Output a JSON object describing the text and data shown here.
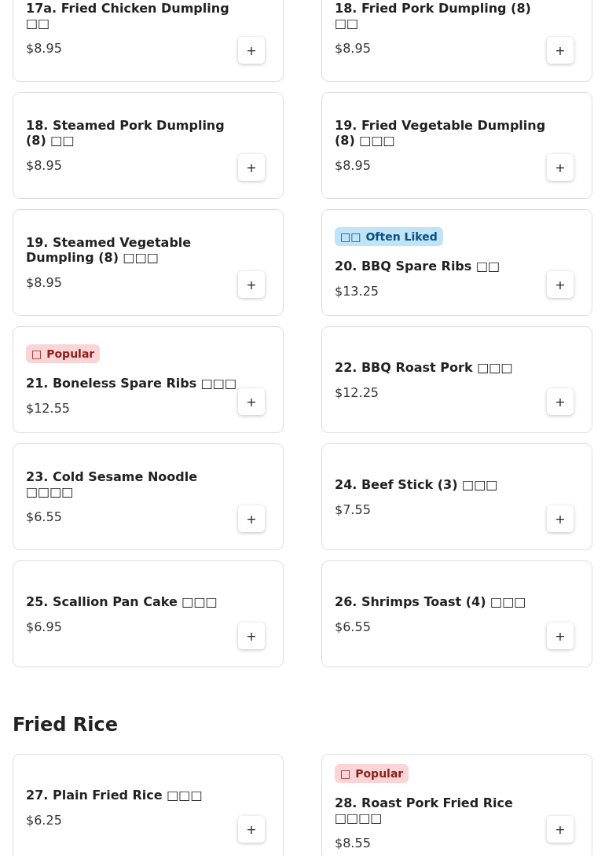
{
  "sections": [
    {
      "items": [
        {
          "name": "17a. Fried Chicken Dumpling □□",
          "price": "$8.95",
          "button": "+"
        },
        {
          "name": "18. Fried Pork Dumpling (8) □□",
          "price": "$8.95",
          "button": "+"
        },
        {
          "name": "18. Steamed Pork Dumpling (8) □□",
          "price": "$8.95",
          "button": "+"
        },
        {
          "name": "19. Fried Vegetable Dumpling (8) □□□",
          "price": "$8.95",
          "button": "+"
        },
        {
          "name": "19. Steamed Vegetable Dumpling (8) □□□",
          "price": "$8.95",
          "button": "+"
        },
        {
          "badge": {
            "kind": "often_liked",
            "icon": "□□",
            "label": "Often Liked"
          },
          "name": "20. BBQ Spare Ribs □□",
          "price": "$13.25",
          "button": "+"
        },
        {
          "badge": {
            "kind": "popular",
            "icon": "□",
            "label": "Popular"
          },
          "name": "21. Boneless Spare Ribs □□□",
          "price": "$12.55",
          "button": "+"
        },
        {
          "name": "22. BBQ Roast Pork □□□",
          "price": "$12.25",
          "button": "+"
        },
        {
          "name": "23. Cold Sesame Noodle □□□□",
          "price": "$6.55",
          "button": "+"
        },
        {
          "name": "24. Beef Stick (3) □□□",
          "price": "$7.55",
          "button": "+"
        },
        {
          "name": "25. Scallion Pan Cake □□□",
          "price": "$6.95",
          "button": "+"
        },
        {
          "name": "26. Shrimps Toast (4) □□□",
          "price": "$6.55",
          "button": "+"
        }
      ]
    },
    {
      "title": "Fried Rice",
      "items": [
        {
          "name": "27. Plain Fried Rice □□□",
          "price": "$6.25",
          "button": "+"
        },
        {
          "badge": {
            "kind": "popular",
            "icon": "□",
            "label": "Popular"
          },
          "name": "28. Roast Pork Fried Rice □□□□",
          "price": "$8.55",
          "button": "+"
        }
      ]
    }
  ]
}
